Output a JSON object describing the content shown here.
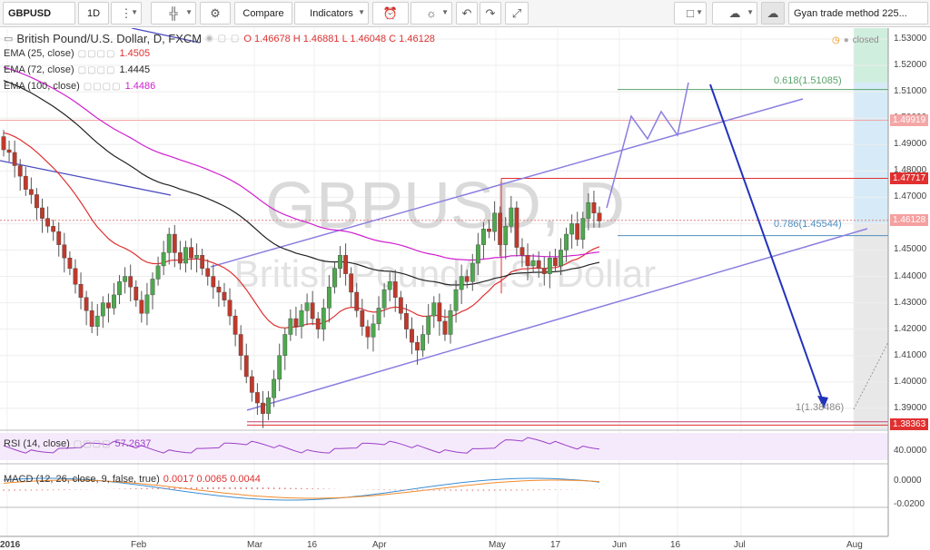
{
  "toolbar": {
    "symbol": "GBPUSD",
    "interval": "1D",
    "compare": "Compare",
    "indicators": "Indicators",
    "study_template": "Gyan trade method 225..."
  },
  "header": {
    "title": "British Pound/U.S. Dollar, D, FXCM",
    "ohlc": "O 1.46678 H 1.46881 L 1.46048 C 1.46128",
    "status": "closed"
  },
  "indicators": [
    {
      "name": "EMA (25, close)",
      "value": "1.4505",
      "color": "#e03030"
    },
    {
      "name": "EMA (72, close)",
      "value": "1.4445",
      "color": "#222222"
    },
    {
      "name": "EMA (100, close)",
      "value": "1.4486",
      "color": "#d020d0"
    }
  ],
  "watermark": {
    "symbol": "GBPUSD, D",
    "name": "British Pound/U.S. Dollar"
  },
  "price_axis": {
    "ticks": [
      "1.53000",
      "1.52000",
      "1.51000",
      "1.50000",
      "1.49000",
      "1.48000",
      "1.47000",
      "1.45000",
      "1.44000",
      "1.43000",
      "1.42000",
      "1.41000",
      "1.40000",
      "1.39000"
    ],
    "labels": [
      {
        "text": "1.49919",
        "color": "#f4a6a6",
        "value": 1.49919
      },
      {
        "text": "1.47717",
        "color": "#e03030",
        "value": 1.47717
      },
      {
        "text": "1.46128",
        "color": "#f5a0a0",
        "value": 1.46128
      },
      {
        "text": "1.38363",
        "color": "#e03030",
        "value": 1.38363
      }
    ]
  },
  "fib_labels": {
    "f618": "0.618(1.51085)",
    "f786": "0.786(1.45544)",
    "f1": "1(1.38486)"
  },
  "rsi": {
    "label": "RSI (14, close)",
    "value": "57.2637",
    "tick": "40.0000"
  },
  "macd": {
    "label": "MACD (12, 26, close, 9, false, true)",
    "values": "0.0017 0.0065 0.0044",
    "ticks": [
      "0.0000",
      "-0.0200"
    ]
  },
  "date_axis": [
    "2016",
    "Feb",
    "Mar",
    "16",
    "Apr",
    "May",
    "17",
    "Jun",
    "16",
    "Jul",
    "Aug"
  ],
  "chart_data": {
    "type": "candlestick",
    "symbol": "GBPUSD",
    "ylim": [
      1.378,
      1.535
    ],
    "last_close": 1.46128,
    "levels": [
      1.51085,
      1.47717,
      1.46128,
      1.45544,
      1.38486,
      1.38363
    ]
  }
}
